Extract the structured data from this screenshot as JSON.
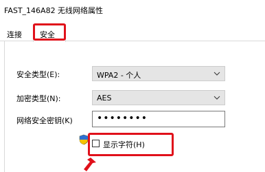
{
  "window": {
    "title": "FAST_146A82 无线网络属性"
  },
  "tabs": [
    {
      "label": "连接"
    },
    {
      "label": "安全"
    }
  ],
  "form": {
    "security_type_label": "安全类型(E):",
    "security_type_value": "WPA2 - 个人",
    "encryption_type_label": "加密类型(N):",
    "encryption_type_value": "AES",
    "network_key_label": "网络安全密钥(K)",
    "network_key_value": "••••••••",
    "show_chars_label": "显示字符(H)"
  },
  "colors": {
    "highlight": "#e0101a",
    "select_bg": "#e5e5e5"
  },
  "icons": {
    "shield": "uac-shield-icon",
    "dropdown": "chevron-down-icon",
    "annotation": "red-arrow-icon"
  }
}
